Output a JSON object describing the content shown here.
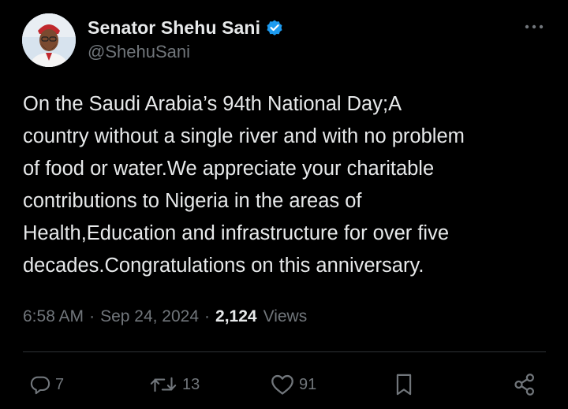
{
  "author": {
    "display_name": "Senator Shehu Sani",
    "handle": "@ShehuSani",
    "verified_color": "#1d9bf0"
  },
  "tweet": {
    "text": "On the Saudi Arabia’s  94th National Day;A\ncountry without a single river and with no problem\nof food or water.We appreciate your charitable\ncontributions to Nigeria in the areas of\nHealth,Education and infrastructure for over five\ndecades.Congratulations on this anniversary.",
    "time": "6:58 AM",
    "separator": "·",
    "date": "Sep 24, 2024",
    "views_count": "2,124",
    "views_label": "Views"
  },
  "actions": {
    "reply": {
      "icon": "reply-icon",
      "count": "7"
    },
    "retweet": {
      "icon": "retweet-icon",
      "count": "13"
    },
    "like": {
      "icon": "heart-icon",
      "count": "91"
    },
    "bookmark": {
      "icon": "bookmark-icon"
    },
    "share": {
      "icon": "share-icon"
    }
  },
  "colors": {
    "background": "#000000",
    "text_primary": "#e7e9ea",
    "text_secondary": "#71767b",
    "divider": "#2f3336",
    "accent": "#1d9bf0"
  }
}
